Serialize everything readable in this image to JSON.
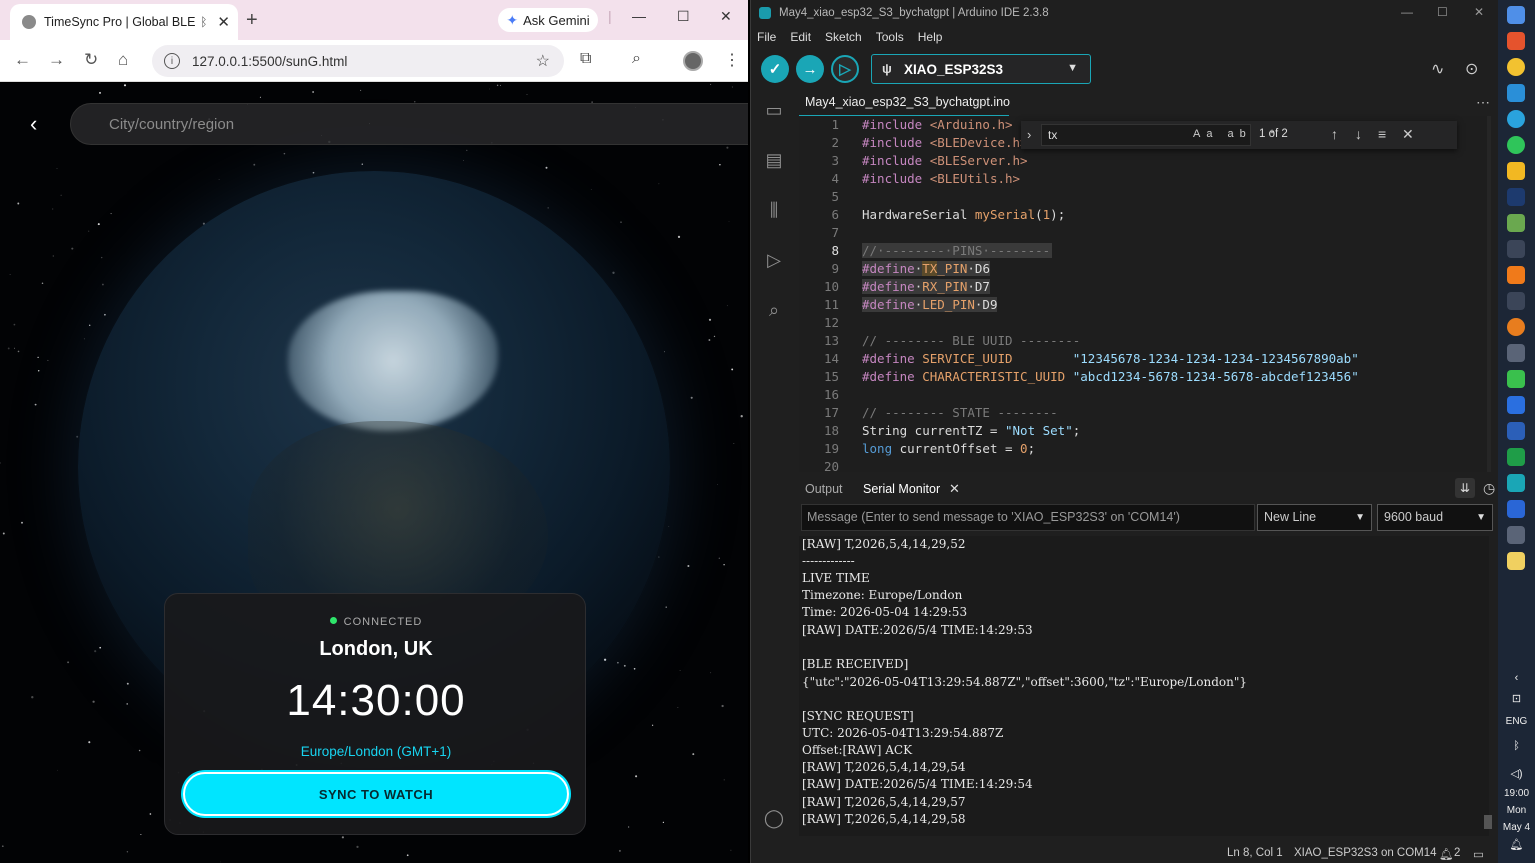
{
  "browser": {
    "tab_title": "TimeSync Pro | Global BLE",
    "new_tab": "+",
    "ask_gemini": "Ask Gemini",
    "url": "127.0.0.1:5500/sunG.html"
  },
  "page": {
    "search_placeholder": "City/country/region",
    "status": "CONNECTED",
    "city": "London, UK",
    "time": "14:30:00",
    "timezone": "Europe/London (GMT+1)",
    "sync_button": "SYNC TO WATCH",
    "accent_color": "#00e5ff",
    "status_color": "#2ee56b"
  },
  "ide": {
    "title": "May4_xiao_esp32_S3_bychatgpt | Arduino IDE 2.3.8",
    "menu": [
      "File",
      "Edit",
      "Sketch",
      "Tools",
      "Help"
    ],
    "board": "XIAO_ESP32S3",
    "file_tab": "May4_xiao_esp32_S3_bychatgpt.ino",
    "find": {
      "query": "tx",
      "opts": "Aa ab .*",
      "count": "1 of 2"
    },
    "line_numbers": [
      "1",
      "2",
      "3",
      "4",
      "5",
      "6",
      "7",
      "8",
      "9",
      "10",
      "11",
      "12",
      "13",
      "14",
      "15",
      "16",
      "17",
      "18",
      "19",
      "20"
    ],
    "panel": {
      "output_tab": "Output",
      "serial_tab": "Serial Monitor"
    },
    "message_placeholder": "Message (Enter to send message to 'XIAO_ESP32S3' on 'COM14')",
    "line_ending": "New Line",
    "baud": "9600 baud",
    "serial_lines": [
      "[RAW] T,2026,5,4,14,29,52",
      "-------------",
      "LIVE TIME",
      "Timezone: Europe/London",
      "Time: 2026-05-04 14:29:53",
      "[RAW] DATE:2026/5/4 TIME:14:29:53",
      "",
      "[BLE RECEIVED]",
      "{\"utc\":\"2026-05-04T13:29:54.887Z\",\"offset\":3600,\"tz\":\"Europe/London\"}",
      "",
      "[SYNC REQUEST]",
      "UTC: 2026-05-04T13:29:54.887Z",
      "Offset:[RAW] ACK",
      "[RAW] T,2026,5,4,14,29,54",
      "[RAW] DATE:2026/5/4 TIME:14:29:54",
      "[RAW] T,2026,5,4,14,29,57",
      "[RAW] T,2026,5,4,14,29,58"
    ],
    "status": {
      "position": "Ln 8, Col 1",
      "board_port": "XIAO_ESP32S3 on COM14",
      "notifications": "2"
    }
  },
  "tray": {
    "lang": "ENG",
    "time": "19:00",
    "day": "Mon",
    "date": "May 4"
  }
}
